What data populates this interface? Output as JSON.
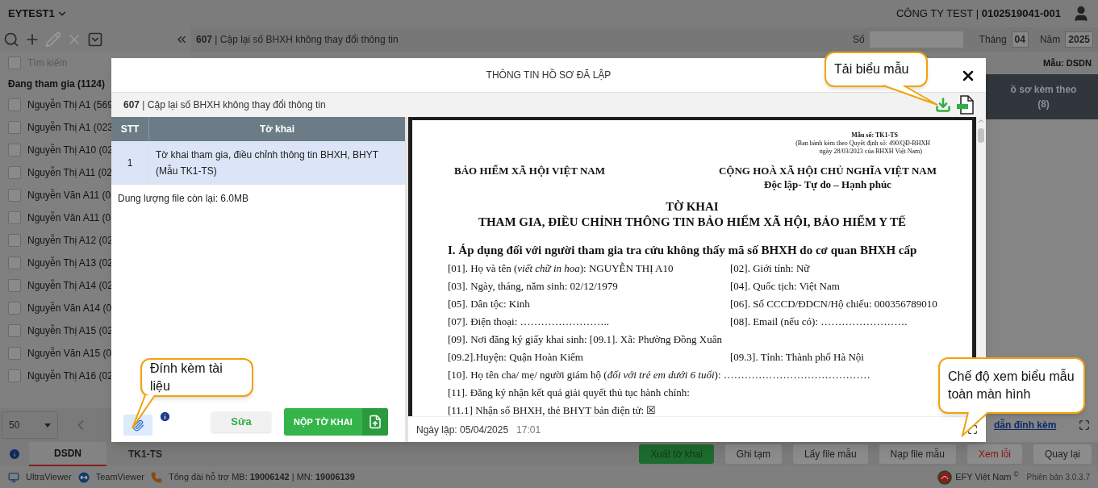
{
  "header": {
    "account": "EYTEST1",
    "company": "CÔNG TY TEST | **0102519041-001**"
  },
  "toolbar": [
    {
      "kind": "search",
      "disabled": false
    },
    {
      "kind": "add",
      "disabled": false
    },
    {
      "kind": "edit",
      "disabled": true
    },
    {
      "kind": "delete",
      "disabled": true
    },
    {
      "kind": "dropdown",
      "disabled": false
    }
  ],
  "record": {
    "title": "**607** | Cập lại số BHXH không thay đổi thông tin"
  },
  "period": {
    "number_label": "Số",
    "month_label": "Tháng",
    "month": "04",
    "year_label": "Năm",
    "year": "2025"
  },
  "sidebar": {
    "select_all_checked": false,
    "search_placeholder": "Tìm kiếm",
    "group": "Đang tham gia (1124)",
    "items": [
      {
        "name": "Nguyễn Thị A1 (569",
        "checked": false
      },
      {
        "name": "Nguyễn Thị A1 (023",
        "checked": false
      },
      {
        "name": "Nguyễn Thị A10 (02",
        "checked": false
      },
      {
        "name": "Nguyễn Thị A11 (02",
        "checked": false
      },
      {
        "name": "Nguyễn Văn A11 (0",
        "checked": false
      },
      {
        "name": "Nguyễn Văn A11 (0",
        "checked": false
      },
      {
        "name": "Nguyễn Thị A12 (02",
        "checked": false
      },
      {
        "name": "Nguyễn Thị A13 (02",
        "checked": false
      },
      {
        "name": "Nguyễn Thị A14 (02",
        "checked": false
      },
      {
        "name": "Nguyễn Văn A14 (0",
        "checked": false
      },
      {
        "name": "Nguyễn Thị A15 (02",
        "checked": false
      },
      {
        "name": "Nguyễn Văn A15 (0",
        "checked": false
      },
      {
        "name": "Nguyễn Thị A16 (02",
        "checked": false
      }
    ],
    "page_size": "50"
  },
  "sidebar_tabs": [
    {
      "label": "DSDN",
      "selected": true
    },
    {
      "label": "TK1-TS",
      "selected": false
    }
  ],
  "main": {
    "template": "Mẫu: DSDN",
    "attachments_label": "ồ sơ kèm theo",
    "attachments_count": "(8)",
    "guide_link": "dẫn đính kèm"
  },
  "actions": [
    {
      "label": "Xuất tờ khai",
      "kind": "primary"
    },
    {
      "label": "Ghi tạm",
      "kind": "default"
    },
    {
      "label": "Lấy file mẫu",
      "kind": "default"
    },
    {
      "label": "Nạp file mẫu",
      "kind": "default"
    },
    {
      "label": "Xem lỗi",
      "kind": "danger"
    },
    {
      "label": "Quay lại",
      "kind": "default"
    }
  ],
  "modal": {
    "title": "THÔNG TIN HỒ SƠ ĐÃ LẬP",
    "subtitle": "**607** | Cập lại số BHXH không thay đổi thông tin",
    "table": {
      "columns": [
        "STT",
        "Tờ khai"
      ],
      "rows": [
        {
          "cells": [
            "1",
            "Tờ khai tham gia, điều chỉnh thông tin BHXH, BHYT (Mẫu TK1-TS)"
          ],
          "selected": true
        }
      ]
    },
    "quota": "Dung lượng file còn lại: 6.0MB",
    "edit_button": "Sửa",
    "submit_button": "NỘP TỜ KHAI",
    "created_label": "Ngày lập: 05/04/2025",
    "created_time": "17:01",
    "document": {
      "form_no": "Mẫu số: TK1-TS",
      "issued": [
        "(Ban hành kèm theo Quyết định số: 490/QĐ-BHXH",
        "ngày 28/03/2023 của BHXH Việt Nam)"
      ],
      "agency": "BẢO HIỂM XÃ HỘI VIỆT NAM",
      "nation": "CỘNG HOÀ XÃ HỘI CHỦ NGHĨA VIỆT NAM",
      "motto": "Độc lập- Tự do – Hạnh phúc",
      "title": "TỜ KHAI",
      "subtitle": "THAM GIA, ĐIỀU CHỈNH THÔNG TIN BẢO HIỂM XÃ HỘI, BẢO HIỂM Y TẾ",
      "section": "I. Áp dụng đối với người tham gia tra cứu không thấy mã số BHXH do cơ quan BHXH cấp",
      "lines": [
        {
          "left": "[01]. Họ và tên (*viết chữ in hoa*): NGUYỄN THỊ A10",
          "right": "[02]. Giới tính: Nữ"
        },
        {
          "left": "[03]. Ngày, tháng, năm sinh: 02/12/1979",
          "right": "[04]. Quốc tịch: Việt Nam"
        },
        {
          "left": "[05]. Dân tộc: Kinh",
          "right": "[06]. Số CCCD/ĐDCN/Hộ chiếu: 000356789010"
        },
        {
          "left": "[07]. Điện thoại: ……………………..",
          "right": "[08]. Email (nếu có): ……………………."
        },
        {
          "left": "[09]. Nơi đăng ký giấy khai sinh: [09.1]. Xã: Phường Đồng Xuân"
        },
        {
          "left": "[09.2].Huyện: Quận Hoàn Kiếm",
          "right": "[09.3]. Tỉnh: Thành phố Hà Nội"
        },
        {
          "left": "[10]. Họ tên cha/ mẹ/ người giám hộ (*đối với trẻ em dưới 6 tuổi*): ……………………………………"
        },
        {
          "left": "[11]. Đăng ký nhận kết quả giải quyết thủ tục hành chính:"
        },
        {
          "left": "[11.1] Nhận số BHXH, thẻ BHYT bản điện tử: ☒"
        }
      ]
    }
  },
  "callouts": [
    {
      "text": "Tải biểu mẫu"
    },
    {
      "text": "Đính kèm tài liệu"
    },
    {
      "text": "Chế độ xem biểu mẫu toàn màn hình"
    }
  ],
  "status_bar": {
    "tools": [
      "UltraViewer",
      "TeamViewer"
    ],
    "hotline": "Tổng đài hỗ trợ MB: **19006142** | MN: **19006139**",
    "brand": "EFY Việt Nam $^{©}$",
    "version": "Phiên bản 3.0.3.7"
  }
}
